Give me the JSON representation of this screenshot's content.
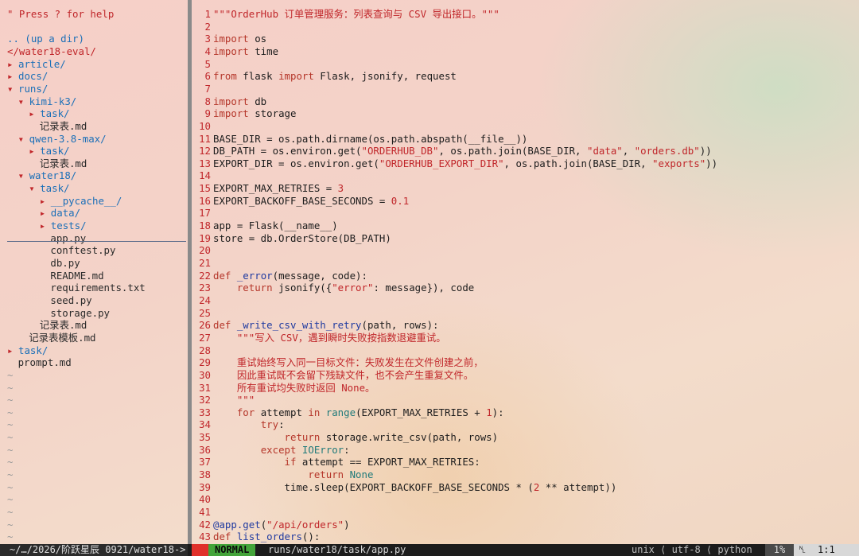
{
  "tree": {
    "help_hint": "\" Press ? for help",
    "up_dir": ".. (up a dir)",
    "root": "</water18-eval/",
    "items": [
      {
        "prefix": "▸ ",
        "label": "article/",
        "indent": 0,
        "kind": "dir"
      },
      {
        "prefix": "▸ ",
        "label": "docs/",
        "indent": 0,
        "kind": "dir"
      },
      {
        "prefix": "▾ ",
        "label": "runs/",
        "indent": 0,
        "kind": "dir"
      },
      {
        "prefix": "▾ ",
        "label": "kimi-k3/",
        "indent": 1,
        "kind": "dir"
      },
      {
        "prefix": "▸ ",
        "label": "task/",
        "indent": 2,
        "kind": "dir"
      },
      {
        "prefix": "",
        "label": "记录表.md",
        "indent": 3,
        "kind": "file"
      },
      {
        "prefix": "▾ ",
        "label": "qwen-3.8-max/",
        "indent": 1,
        "kind": "dir"
      },
      {
        "prefix": "▸ ",
        "label": "task/",
        "indent": 2,
        "kind": "dir"
      },
      {
        "prefix": "",
        "label": "记录表.md",
        "indent": 3,
        "kind": "file"
      },
      {
        "prefix": "▾ ",
        "label": "water18/",
        "indent": 1,
        "kind": "dir"
      },
      {
        "prefix": "▾ ",
        "label": "task/",
        "indent": 2,
        "kind": "dir"
      },
      {
        "prefix": "▸ ",
        "label": "__pycache__/",
        "indent": 3,
        "kind": "dir"
      },
      {
        "prefix": "▸ ",
        "label": "data/",
        "indent": 3,
        "kind": "dir"
      },
      {
        "prefix": "▸ ",
        "label": "tests/",
        "indent": 3,
        "kind": "dir"
      },
      {
        "prefix": "",
        "label": "app.py",
        "indent": 4,
        "kind": "file"
      },
      {
        "prefix": "",
        "label": "conftest.py",
        "indent": 4,
        "kind": "file"
      },
      {
        "prefix": "",
        "label": "db.py",
        "indent": 4,
        "kind": "file"
      },
      {
        "prefix": "",
        "label": "README.md",
        "indent": 4,
        "kind": "file"
      },
      {
        "prefix": "",
        "label": "requirements.txt",
        "indent": 4,
        "kind": "file"
      },
      {
        "prefix": "",
        "label": "seed.py",
        "indent": 4,
        "kind": "file"
      },
      {
        "prefix": "",
        "label": "storage.py",
        "indent": 4,
        "kind": "file"
      },
      {
        "prefix": "",
        "label": "记录表.md",
        "indent": 3,
        "kind": "file"
      },
      {
        "prefix": "",
        "label": "记录表模板.md",
        "indent": 2,
        "kind": "file"
      },
      {
        "prefix": "▸ ",
        "label": "task/",
        "indent": 0,
        "kind": "dir"
      },
      {
        "prefix": "",
        "label": "prompt.md",
        "indent": 1,
        "kind": "file"
      }
    ],
    "tilde": "~"
  },
  "editor": {
    "lines": [
      [
        [
          "str",
          "\"\"\"OrderHub 订单管理服务：列表查询与 CSV 导出接口。\"\"\""
        ]
      ],
      [],
      [
        [
          "kw",
          "import"
        ],
        [
          "txt",
          " os"
        ]
      ],
      [
        [
          "kw",
          "import"
        ],
        [
          "txt",
          " time"
        ]
      ],
      [],
      [
        [
          "kw",
          "from"
        ],
        [
          "txt",
          " flask "
        ],
        [
          "kw",
          "import"
        ],
        [
          "txt",
          " Flask, jsonify, request"
        ]
      ],
      [],
      [
        [
          "kw",
          "import"
        ],
        [
          "txt",
          " db"
        ]
      ],
      [
        [
          "kw",
          "import"
        ],
        [
          "txt",
          " storage"
        ]
      ],
      [],
      [
        [
          "txt",
          "BASE_DIR = os.path.dirname(os.path.abspath(__file__))"
        ]
      ],
      [
        [
          "txt",
          "DB_PATH = os.environ.get("
        ],
        [
          "str",
          "\"ORDERHUB_DB\""
        ],
        [
          "txt",
          ", os.path.join(BASE_DIR, "
        ],
        [
          "str",
          "\"data\""
        ],
        [
          "txt",
          ", "
        ],
        [
          "str",
          "\"orders.db\""
        ],
        [
          "txt",
          "))"
        ]
      ],
      [
        [
          "txt",
          "EXPORT_DIR = os.environ.get("
        ],
        [
          "str",
          "\"ORDERHUB_EXPORT_DIR\""
        ],
        [
          "txt",
          ", os.path.join(BASE_DIR, "
        ],
        [
          "str",
          "\"exports\""
        ],
        [
          "txt",
          "))"
        ]
      ],
      [],
      [
        [
          "txt",
          "EXPORT_MAX_RETRIES = "
        ],
        [
          "num",
          "3"
        ]
      ],
      [
        [
          "txt",
          "EXPORT_BACKOFF_BASE_SECONDS = "
        ],
        [
          "num",
          "0.1"
        ]
      ],
      [],
      [
        [
          "txt",
          "app = Flask(__name__)"
        ]
      ],
      [
        [
          "txt",
          "store = db.OrderStore(DB_PATH)"
        ]
      ],
      [],
      [],
      [
        [
          "kw",
          "def"
        ],
        [
          "fn",
          " _error"
        ],
        [
          "txt",
          "(message, code):"
        ]
      ],
      [
        [
          "txt",
          "    "
        ],
        [
          "kw",
          "return"
        ],
        [
          "txt",
          " jsonify({"
        ],
        [
          "str",
          "\"error\""
        ],
        [
          "txt",
          ": message}), code"
        ]
      ],
      [],
      [],
      [
        [
          "kw",
          "def"
        ],
        [
          "fn",
          " _write_csv_with_retry"
        ],
        [
          "txt",
          "(path, rows):"
        ]
      ],
      [
        [
          "txt",
          "    "
        ],
        [
          "str",
          "\"\"\"写入 CSV，遇到瞬时失败按指数退避重试。"
        ]
      ],
      [],
      [
        [
          "txt",
          "    "
        ],
        [
          "str",
          "重试始终写入同一目标文件：失败发生在文件创建之前，"
        ]
      ],
      [
        [
          "txt",
          "    "
        ],
        [
          "str",
          "因此重试既不会留下残缺文件，也不会产生重复文件。"
        ]
      ],
      [
        [
          "txt",
          "    "
        ],
        [
          "str",
          "所有重试均失败时返回 None。"
        ]
      ],
      [
        [
          "txt",
          "    "
        ],
        [
          "str",
          "\"\"\""
        ]
      ],
      [
        [
          "txt",
          "    "
        ],
        [
          "kw",
          "for"
        ],
        [
          "txt",
          " attempt "
        ],
        [
          "kw",
          "in"
        ],
        [
          "blt",
          " range"
        ],
        [
          "txt",
          "(EXPORT_MAX_RETRIES + "
        ],
        [
          "num",
          "1"
        ],
        [
          "txt",
          "):"
        ]
      ],
      [
        [
          "txt",
          "        "
        ],
        [
          "kw",
          "try"
        ],
        [
          "txt",
          ":"
        ]
      ],
      [
        [
          "txt",
          "            "
        ],
        [
          "kw",
          "return"
        ],
        [
          "txt",
          " storage.write_csv(path, rows)"
        ]
      ],
      [
        [
          "txt",
          "        "
        ],
        [
          "kw",
          "except"
        ],
        [
          "blt",
          " IOError"
        ],
        [
          "txt",
          ":"
        ]
      ],
      [
        [
          "txt",
          "            "
        ],
        [
          "kw",
          "if"
        ],
        [
          "txt",
          " attempt == EXPORT_MAX_RETRIES:"
        ]
      ],
      [
        [
          "txt",
          "                "
        ],
        [
          "kw",
          "return"
        ],
        [
          "blt",
          " None"
        ]
      ],
      [
        [
          "txt",
          "            time.sleep(EXPORT_BACKOFF_BASE_SECONDS * ("
        ],
        [
          "num",
          "2"
        ],
        [
          "txt",
          " ** attempt))"
        ]
      ],
      [],
      [],
      [
        [
          "fn",
          "@app.get"
        ],
        [
          "txt",
          "("
        ],
        [
          "str",
          "\"/api/orders\""
        ],
        [
          "txt",
          ")"
        ]
      ],
      [
        [
          "kw",
          "def"
        ],
        [
          "fn",
          " list_orders"
        ],
        [
          "txt",
          "():"
        ]
      ]
    ]
  },
  "status": {
    "left": "~/…/2026/阶跃星辰 0921/water18->",
    "mode": "NORMAL",
    "file": "runs/water18/task/app.py",
    "encoding": "unix ⟨ utf-8 ⟨ python",
    "percent": "1%",
    "position": "␤  1:1"
  },
  "colors": {
    "accent_red": "#e0302a",
    "mode_green": "#43a43a",
    "dir_blue": "#1a6fb8"
  }
}
